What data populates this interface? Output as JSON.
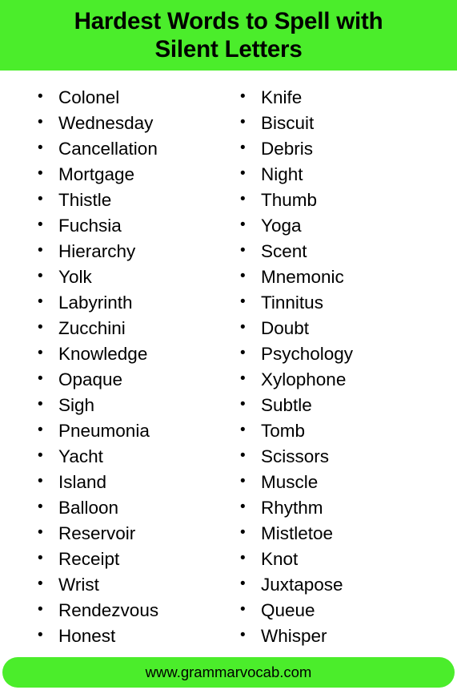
{
  "header": {
    "title": "Hardest Words to Spell with Silent Letters",
    "title_line_1": "Hardest Words to Spell with",
    "title_line_2": "Silent Letters",
    "background_color": "#4BED2B",
    "text_color": "#000000"
  },
  "bullet_glyph": "•",
  "columns": [
    {
      "name": "left-column",
      "words": [
        "Colonel",
        "Wednesday",
        "Cancellation",
        "Mortgage",
        "Thistle",
        "Fuchsia",
        "Hierarchy",
        "Yolk",
        "Labyrinth",
        "Zucchini",
        "Knowledge",
        "Opaque",
        "Sigh",
        "Pneumonia",
        "Yacht",
        "Island",
        "Balloon",
        "Reservoir",
        "Receipt",
        "Wrist",
        "Rendezvous",
        "Honest"
      ]
    },
    {
      "name": "right-column",
      "words": [
        "Knife",
        "Biscuit",
        "Debris",
        "Night",
        "Thumb",
        "Yoga",
        "Scent",
        "Mnemonic",
        "Tinnitus",
        "Doubt",
        "Psychology",
        "Xylophone",
        "Subtle",
        "Tomb",
        "Scissors",
        "Muscle",
        "Rhythm",
        "Mistletoe",
        "Knot",
        "Juxtapose",
        "Queue",
        "Whisper"
      ]
    }
  ],
  "footer": {
    "website": "www.grammarvocab.com",
    "background_color": "#4BED2B",
    "text_color": "#000000"
  }
}
